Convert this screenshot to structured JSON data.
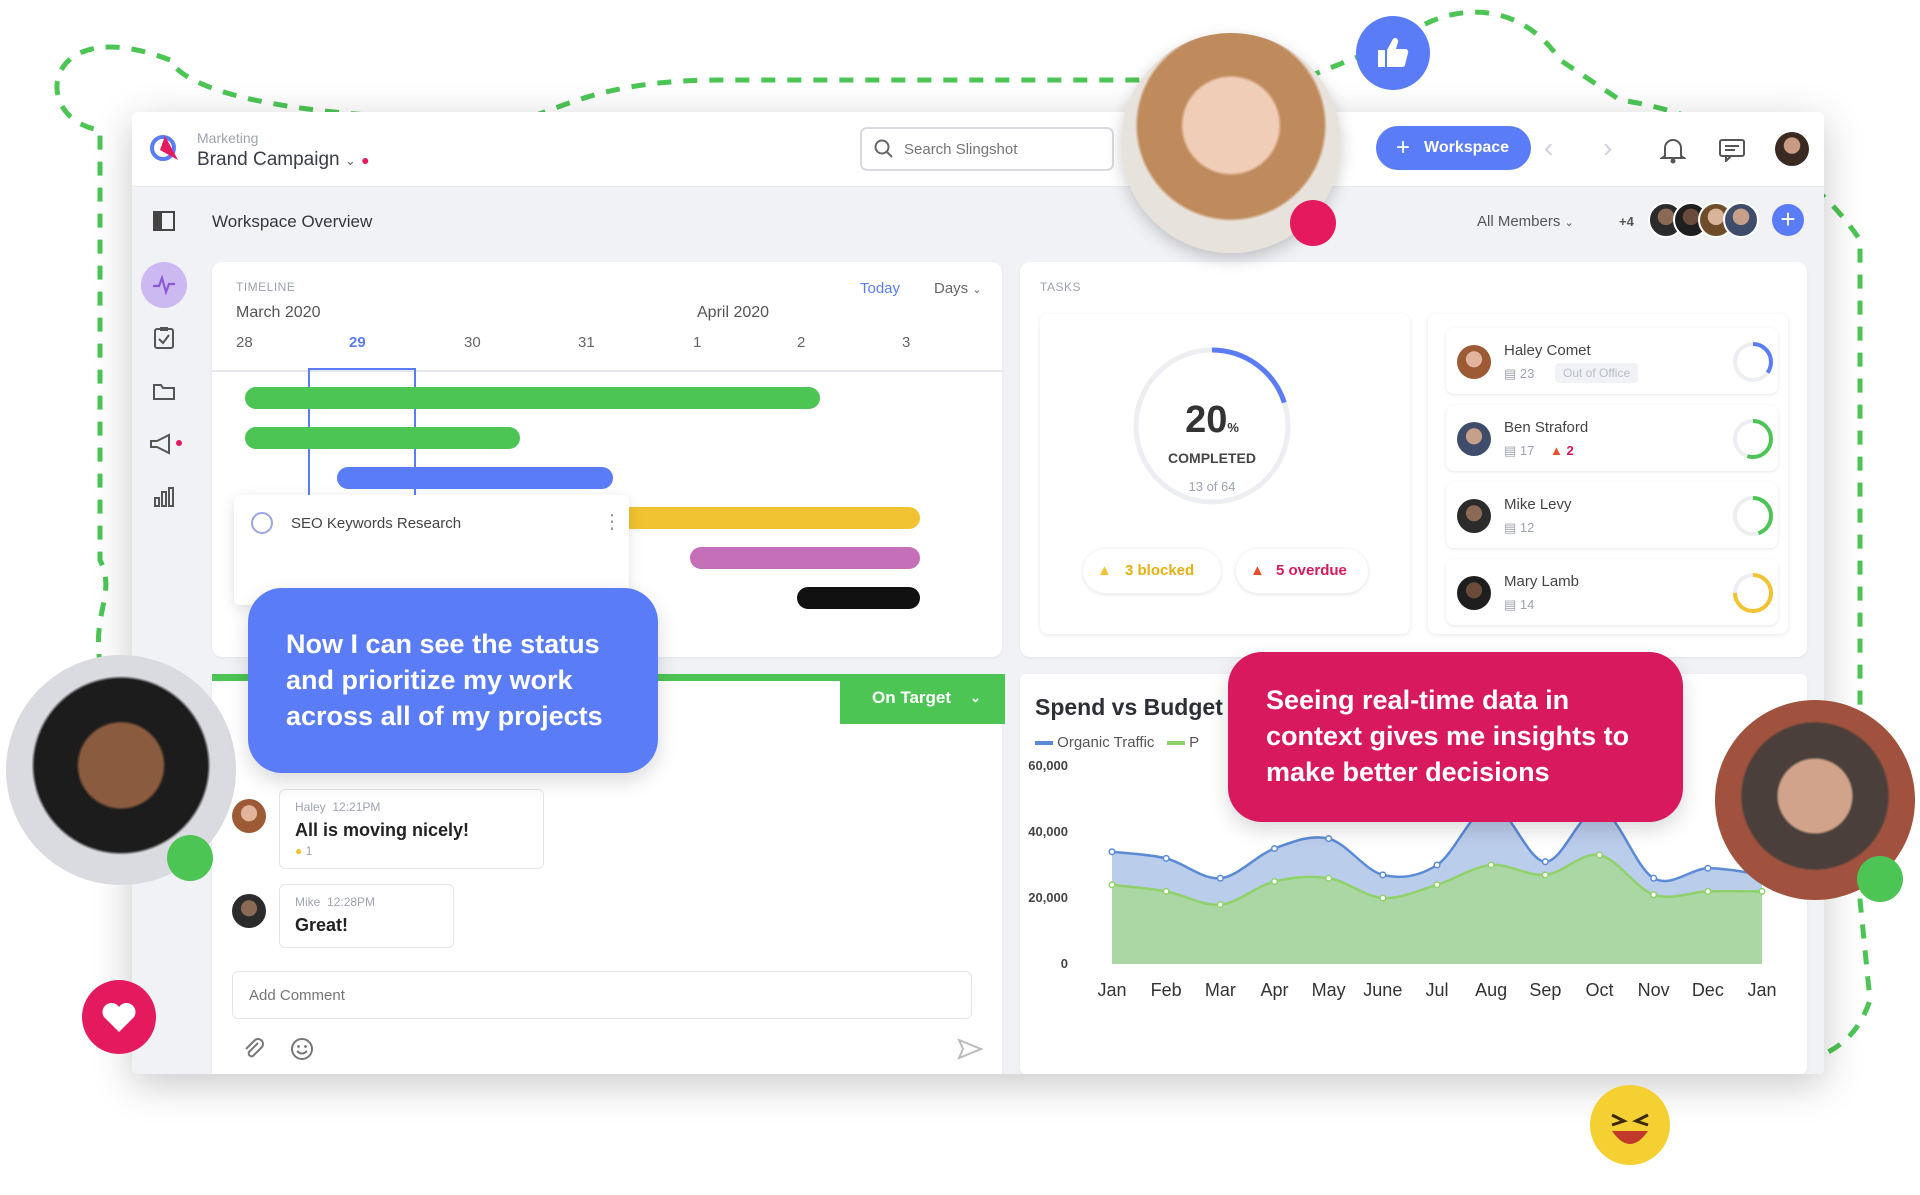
{
  "colors": {
    "accent": "#5b7cf7",
    "green": "#4cc555",
    "pink": "#d9195e",
    "yellow": "#f1c232",
    "purple": "#c46fb8"
  },
  "header": {
    "project_category": "Marketing",
    "project_name": "Brand Campaign",
    "search_placeholder": "Search Slingshot",
    "workspace_button": "Workspace"
  },
  "page": {
    "title": "Workspace Overview",
    "members_filter": "All Members",
    "extra_members": "+4"
  },
  "timeline": {
    "label": "TIMELINE",
    "today": "Today",
    "view": "Days",
    "month1": "March 2020",
    "month2": "April 2020",
    "days": [
      "28",
      "29",
      "30",
      "31",
      "1",
      "2",
      "3"
    ],
    "task_name": "SEO Keywords Research"
  },
  "tasks": {
    "label": "TASKS",
    "percent": "20",
    "percent_sign": "%",
    "completed": "COMPLETED",
    "progress_text": "13 of 64",
    "progress_fraction": 0.2,
    "blocked": "3 blocked",
    "overdue": "5 overdue"
  },
  "members": [
    {
      "name": "Haley Comet",
      "tasks": "23",
      "badge": "Out of Office",
      "progress": 0.35,
      "ring": "#5b7cf7"
    },
    {
      "name": "Ben Straford",
      "tasks": "17",
      "overdue": "2",
      "progress": 0.55,
      "ring": "#4cc555"
    },
    {
      "name": "Mike Levy",
      "tasks": "12",
      "progress": 0.45,
      "ring": "#4cc555"
    },
    {
      "name": "Mary Lamb",
      "tasks": "14",
      "progress": 0.75,
      "ring": "#f1c232"
    }
  ],
  "status": {
    "label": "On Target"
  },
  "comments": [
    {
      "author": "Haley",
      "time": "12:21PM",
      "text": "All is moving nicely!",
      "reaction_count": "1"
    },
    {
      "author": "Mike",
      "time": "12:28PM",
      "text": "Great!"
    }
  ],
  "comment_input": {
    "placeholder": "Add Comment"
  },
  "bubbles": {
    "left": "Now I can see the status and prioritize my work across all of my projects",
    "right": "Seeing real-time data in context gives me insights to make better decisions"
  },
  "chart_data": {
    "type": "area",
    "title": "Spend vs Budget",
    "categories": [
      "Jan",
      "Feb",
      "Mar",
      "Apr",
      "May",
      "June",
      "Jul",
      "Aug",
      "Sep",
      "Oct",
      "Nov",
      "Dec",
      "Jan"
    ],
    "series": [
      {
        "name": "Organic Traffic",
        "color": "#5b8ad6",
        "values": [
          34000,
          32000,
          26000,
          35000,
          38000,
          27000,
          30000,
          48000,
          31000,
          47000,
          26000,
          29000,
          27000
        ]
      },
      {
        "name": "P",
        "color": "#8fd16a",
        "values": [
          24000,
          22000,
          18000,
          25000,
          26000,
          20000,
          24000,
          30000,
          27000,
          33000,
          21000,
          22000,
          22000
        ]
      }
    ],
    "y_ticks": [
      "60,000",
      "40,000",
      "20,000",
      "0"
    ],
    "ylim": [
      0,
      60000
    ],
    "grid": false,
    "legend": "top-left"
  }
}
